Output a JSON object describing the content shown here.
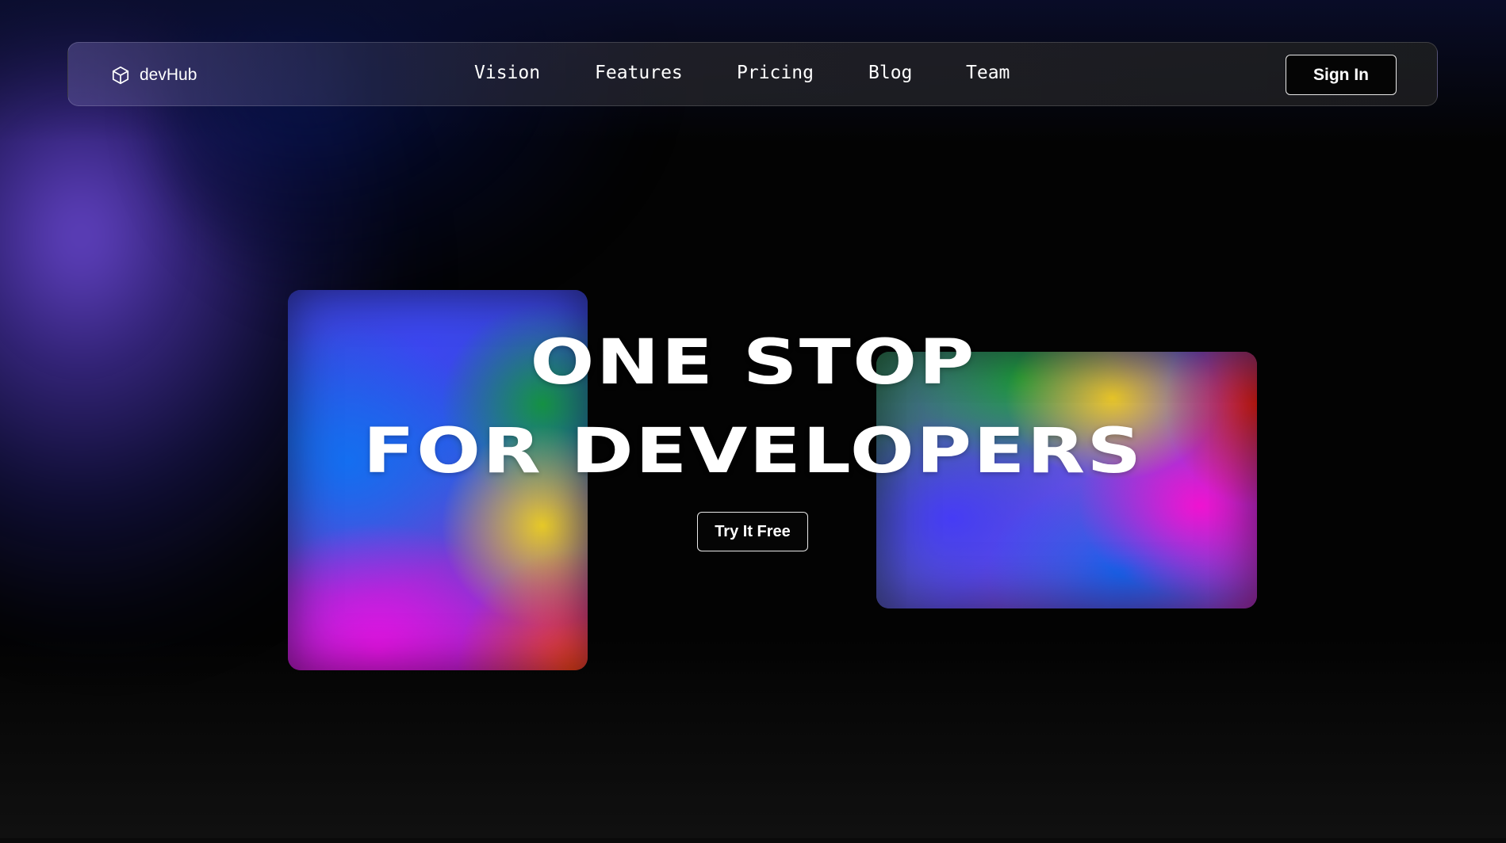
{
  "brand": {
    "name": "devHub",
    "icon": "cube-icon"
  },
  "nav": {
    "links": [
      {
        "label": "Vision"
      },
      {
        "label": "Features"
      },
      {
        "label": "Pricing"
      },
      {
        "label": "Blog"
      },
      {
        "label": "Team"
      }
    ],
    "signin_label": "Sign In"
  },
  "hero": {
    "title_line1": "ONE STOP",
    "title_line2": "FOR DEVELOPERS",
    "cta_label": "Try It Free"
  },
  "colors": {
    "background": "#030303",
    "text": "#ffffff",
    "accent_purple": "#6a48d2",
    "accent_blue": "#1466f0",
    "accent_magenta": "#e614e6",
    "accent_yellow": "#f0d21e",
    "accent_green": "#14963c",
    "accent_red": "#eb1e14"
  }
}
